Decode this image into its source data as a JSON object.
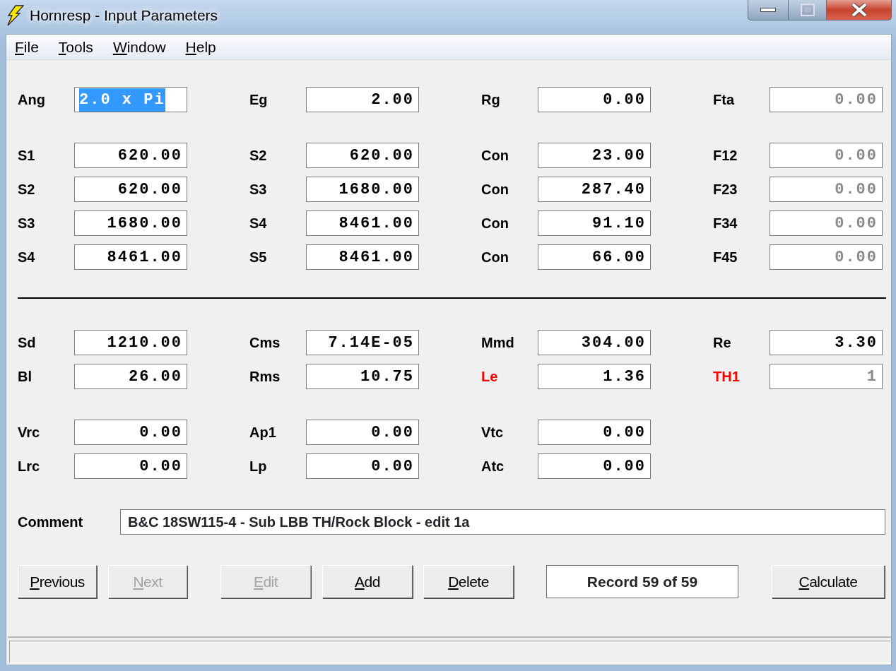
{
  "window": {
    "title": "Hornresp - Input Parameters"
  },
  "menu": [
    {
      "label": "File"
    },
    {
      "label": "Tools"
    },
    {
      "label": "Window"
    },
    {
      "label": "Help"
    }
  ],
  "groups": [
    {
      "divider_before": false,
      "rows": [
        [
          {
            "label": "Ang",
            "value": "2.0 x Pi",
            "selected": true,
            "disabled": false,
            "flagged": false
          },
          {
            "label": "Eg",
            "value": "2.00",
            "selected": false,
            "disabled": false,
            "flagged": false
          },
          {
            "label": "Rg",
            "value": "0.00",
            "selected": false,
            "disabled": false,
            "flagged": false
          },
          {
            "label": "Fta",
            "value": "0.00",
            "selected": false,
            "disabled": true,
            "flagged": false
          }
        ]
      ]
    },
    {
      "divider_before": false,
      "rows": [
        [
          {
            "label": "S1",
            "value": "620.00",
            "selected": false,
            "disabled": false,
            "flagged": false
          },
          {
            "label": "S2",
            "value": "620.00",
            "selected": false,
            "disabled": false,
            "flagged": false
          },
          {
            "label": "Con",
            "value": "23.00",
            "selected": false,
            "disabled": false,
            "flagged": false
          },
          {
            "label": "F12",
            "value": "0.00",
            "selected": false,
            "disabled": true,
            "flagged": false
          }
        ],
        [
          {
            "label": "S2",
            "value": "620.00",
            "selected": false,
            "disabled": false,
            "flagged": false
          },
          {
            "label": "S3",
            "value": "1680.00",
            "selected": false,
            "disabled": false,
            "flagged": false
          },
          {
            "label": "Con",
            "value": "287.40",
            "selected": false,
            "disabled": false,
            "flagged": false
          },
          {
            "label": "F23",
            "value": "0.00",
            "selected": false,
            "disabled": true,
            "flagged": false
          }
        ],
        [
          {
            "label": "S3",
            "value": "1680.00",
            "selected": false,
            "disabled": false,
            "flagged": false
          },
          {
            "label": "S4",
            "value": "8461.00",
            "selected": false,
            "disabled": false,
            "flagged": false
          },
          {
            "label": "Con",
            "value": "91.10",
            "selected": false,
            "disabled": false,
            "flagged": false
          },
          {
            "label": "F34",
            "value": "0.00",
            "selected": false,
            "disabled": true,
            "flagged": false
          }
        ],
        [
          {
            "label": "S4",
            "value": "8461.00",
            "selected": false,
            "disabled": false,
            "flagged": false
          },
          {
            "label": "S5",
            "value": "8461.00",
            "selected": false,
            "disabled": false,
            "flagged": false
          },
          {
            "label": "Con",
            "value": "66.00",
            "selected": false,
            "disabled": false,
            "flagged": false
          },
          {
            "label": "F45",
            "value": "0.00",
            "selected": false,
            "disabled": true,
            "flagged": false
          }
        ]
      ]
    },
    {
      "divider_before": true,
      "rows": [
        [
          {
            "label": "Sd",
            "value": "1210.00",
            "selected": false,
            "disabled": false,
            "flagged": false
          },
          {
            "label": "Cms",
            "value": "7.14E-05",
            "selected": false,
            "disabled": false,
            "flagged": false
          },
          {
            "label": "Mmd",
            "value": "304.00",
            "selected": false,
            "disabled": false,
            "flagged": false
          },
          {
            "label": "Re",
            "value": "3.30",
            "selected": false,
            "disabled": false,
            "flagged": false
          }
        ],
        [
          {
            "label": "Bl",
            "value": "26.00",
            "selected": false,
            "disabled": false,
            "flagged": false
          },
          {
            "label": "Rms",
            "value": "10.75",
            "selected": false,
            "disabled": false,
            "flagged": false
          },
          {
            "label": "Le",
            "value": "1.36",
            "selected": false,
            "disabled": false,
            "flagged": true
          },
          {
            "label": "TH1",
            "value": "1",
            "selected": false,
            "disabled": true,
            "flagged": true
          }
        ]
      ]
    },
    {
      "divider_before": false,
      "rows": [
        [
          {
            "label": "Vrc",
            "value": "0.00",
            "selected": false,
            "disabled": false,
            "flagged": false
          },
          {
            "label": "Ap1",
            "value": "0.00",
            "selected": false,
            "disabled": false,
            "flagged": false
          },
          {
            "label": "Vtc",
            "value": "0.00",
            "selected": false,
            "disabled": false,
            "flagged": false
          }
        ],
        [
          {
            "label": "Lrc",
            "value": "0.00",
            "selected": false,
            "disabled": false,
            "flagged": false
          },
          {
            "label": "Lp",
            "value": "0.00",
            "selected": false,
            "disabled": false,
            "flagged": false
          },
          {
            "label": "Atc",
            "value": "0.00",
            "selected": false,
            "disabled": false,
            "flagged": false
          }
        ]
      ]
    }
  ],
  "comment": {
    "label": "Comment",
    "value": "B&C 18SW115-4 - Sub LBB TH/Rock Block - edit 1a"
  },
  "buttons": [
    {
      "kind": "button",
      "label": "Previous",
      "disabled": false
    },
    {
      "kind": "button",
      "label": "Next",
      "disabled": true
    },
    {
      "kind": "button",
      "label": "Edit",
      "disabled": true
    },
    {
      "kind": "button",
      "label": "Add",
      "disabled": false
    },
    {
      "kind": "button",
      "label": "Delete",
      "disabled": false
    },
    {
      "kind": "display",
      "label": "Record 59 of 59"
    },
    {
      "kind": "button",
      "label": "Calculate",
      "disabled": false
    }
  ]
}
